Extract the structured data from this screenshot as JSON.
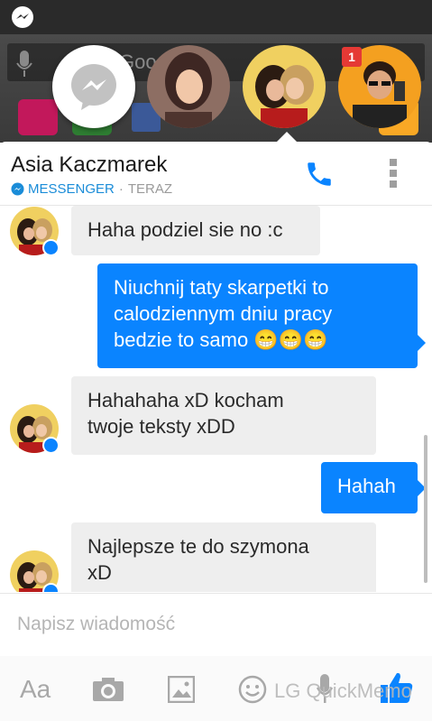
{
  "status_bar": {
    "icons": [
      "messenger-icon"
    ]
  },
  "home_screen": {
    "search_text": "Google",
    "apps": [
      "app-icon",
      "app-icon",
      "facebook-app-icon",
      "app-icon"
    ]
  },
  "chat_heads": {
    "badge_count": "1",
    "heads": [
      "messenger-chathead",
      "contact-chathead-1",
      "contact-chathead-2",
      "contact-chathead-3"
    ]
  },
  "header": {
    "contact_name": "Asia Kaczmarek",
    "source_label": "MESSENGER",
    "separator": "·",
    "time_label": "TERAZ",
    "icons": {
      "call": "phone-icon",
      "menu": "more-vert-icon"
    }
  },
  "messages": [
    {
      "direction": "in",
      "lines": [
        "Haha podziel sie no :c"
      ]
    },
    {
      "direction": "out",
      "lines": [
        "Niuchnij taty skarpetki to",
        "calodziennym dniu pracy",
        "bedzie to samo 😁😁😁"
      ]
    },
    {
      "direction": "in",
      "lines": [
        "Hahahaha xD kocham",
        "twoje teksty xDD"
      ]
    },
    {
      "direction": "out",
      "lines": [
        "Hahah"
      ]
    },
    {
      "direction": "in",
      "lines": [
        "Najlepsze te do szymona",
        "xD"
      ]
    }
  ],
  "composer": {
    "placeholder": "Napisz wiadomość",
    "aa_label": "Aa",
    "overlay_text": "LG QuickMemo",
    "icons": [
      "text-aa-icon",
      "camera-icon",
      "image-icon",
      "emoji-icon",
      "mic-icon",
      "like-icon"
    ]
  },
  "colors": {
    "accent": "#0a84ff",
    "incoming": "#eeeeee",
    "badge": "#e53935"
  }
}
